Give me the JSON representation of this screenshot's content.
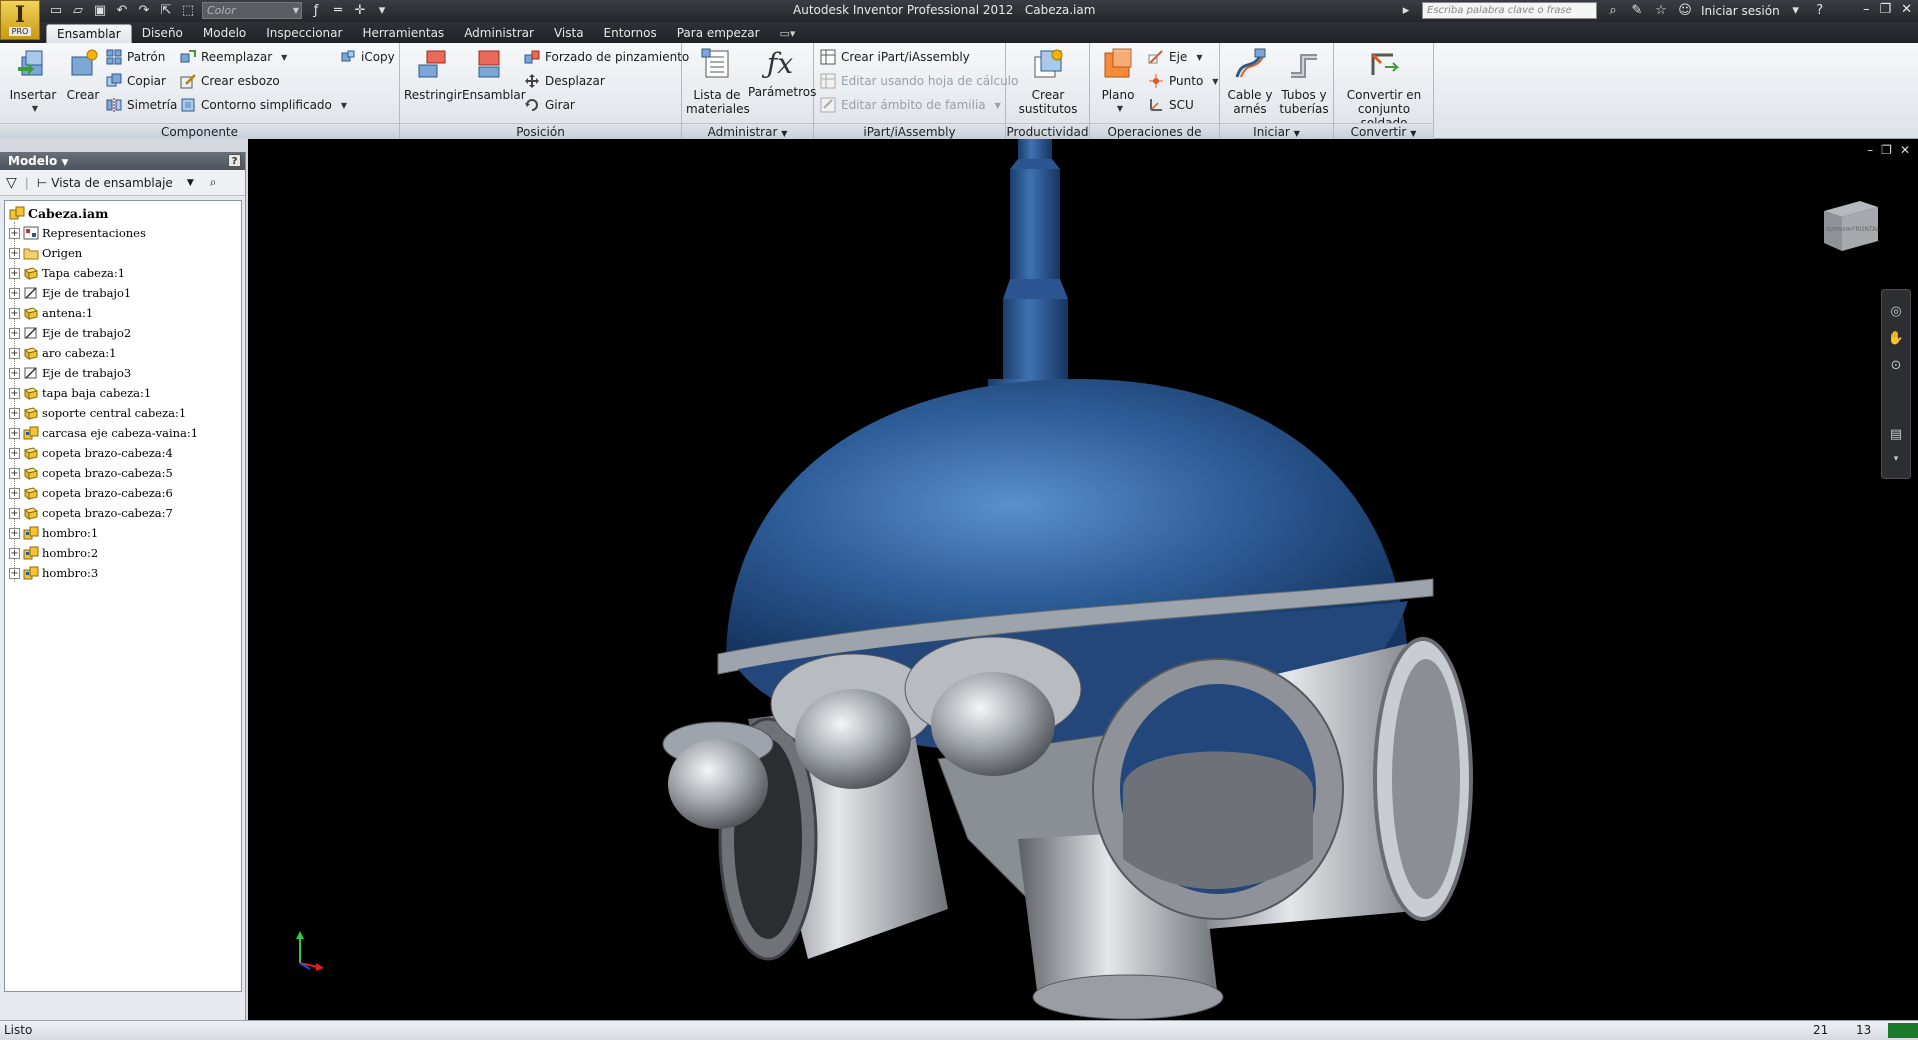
{
  "app": {
    "title": "Autodesk Inventor Professional 2012",
    "document": "Cabeza.iam",
    "edition_badge": "PRO"
  },
  "qat": {
    "color_combo": "Color"
  },
  "search": {
    "placeholder": "Escriba palabra clave o frase"
  },
  "signin": "Iniciar sesión",
  "tabs": [
    {
      "label": "Ensamblar",
      "active": true
    },
    {
      "label": "Diseño"
    },
    {
      "label": "Modelo"
    },
    {
      "label": "Inspeccionar"
    },
    {
      "label": "Herramientas"
    },
    {
      "label": "Administrar"
    },
    {
      "label": "Vista"
    },
    {
      "label": "Entornos"
    },
    {
      "label": "Para empezar"
    }
  ],
  "ribbon": {
    "componente": {
      "label": "Componente",
      "insertar": "Insertar",
      "crear": "Crear",
      "patron": "Patrón",
      "copiar": "Copiar",
      "simetria": "Simetría",
      "reemplazar": "Reemplazar",
      "crear_esbozo": "Crear esbozo",
      "contorno": "Contorno simplificado",
      "icopy": "iCopy"
    },
    "posicion": {
      "label": "Posición",
      "restringir": "Restringir",
      "ensamblar": "Ensamblar",
      "forzado": "Forzado de pinzamiento",
      "desplazar": "Desplazar",
      "girar": "Girar"
    },
    "administrar": {
      "label": "Administrar",
      "lista_line1": "Lista de",
      "lista_line2": "materiales",
      "parametros": "Parámetros"
    },
    "ipart": {
      "label": "iPart/iAssembly",
      "crear": "Crear iPart/iAssembly",
      "editar_hoja": "Editar usando hoja de cálculo",
      "editar_ambito": "Editar ámbito de familia"
    },
    "productividad": {
      "label": "Productividad",
      "crear_line1": "Crear",
      "crear_line2": "sustitutos"
    },
    "operaciones": {
      "label": "Operaciones de trabajo",
      "plano": "Plano",
      "eje": "Eje",
      "punto": "Punto",
      "scu": "SCU"
    },
    "iniciar": {
      "label": "Iniciar",
      "cable_line1": "Cable y",
      "cable_line2": "arnés",
      "tubos_line1": "Tubos y",
      "tubos_line2": "tuberías"
    },
    "convertir": {
      "label": "Convertir",
      "conv_line1": "Convertir en",
      "conv_line2": "conjunto soldado"
    }
  },
  "browser": {
    "title": "Modelo",
    "view": "Vista de ensamblaje",
    "root": "Cabeza.iam",
    "items": [
      {
        "label": "Representaciones",
        "icon": "representations-icon"
      },
      {
        "label": "Origen",
        "icon": "folder-icon"
      },
      {
        "label": "Tapa cabeza:1",
        "icon": "part-icon"
      },
      {
        "label": "Eje de trabajo1",
        "icon": "work-axis-icon"
      },
      {
        "label": "antena:1",
        "icon": "part-icon"
      },
      {
        "label": "Eje de trabajo2",
        "icon": "work-axis-icon"
      },
      {
        "label": "aro cabeza:1",
        "icon": "part-icon"
      },
      {
        "label": "Eje de trabajo3",
        "icon": "work-axis-icon"
      },
      {
        "label": "tapa baja cabeza:1",
        "icon": "part-icon"
      },
      {
        "label": "soporte central cabeza:1",
        "icon": "part-icon"
      },
      {
        "label": "carcasa eje cabeza-vaina:1",
        "icon": "subassembly-icon"
      },
      {
        "label": "copeta brazo-cabeza:4",
        "icon": "part-icon"
      },
      {
        "label": "copeta brazo-cabeza:5",
        "icon": "part-icon"
      },
      {
        "label": "copeta brazo-cabeza:6",
        "icon": "part-icon"
      },
      {
        "label": "copeta brazo-cabeza:7",
        "icon": "part-icon"
      },
      {
        "label": "hombro:1",
        "icon": "subassembly-icon"
      },
      {
        "label": "hombro:2",
        "icon": "subassembly-icon"
      },
      {
        "label": "hombro:3",
        "icon": "subassembly-icon"
      }
    ]
  },
  "viewcube": {
    "left_face": "SUPERIOR",
    "front_face": "FRONTAL"
  },
  "status": {
    "text": "Listo",
    "n1": "21",
    "n2": "13"
  },
  "colors": {
    "dome_blue": "#2f5f9a",
    "metal_gray": "#9ea4ab",
    "viewport_bg": "#000000"
  }
}
